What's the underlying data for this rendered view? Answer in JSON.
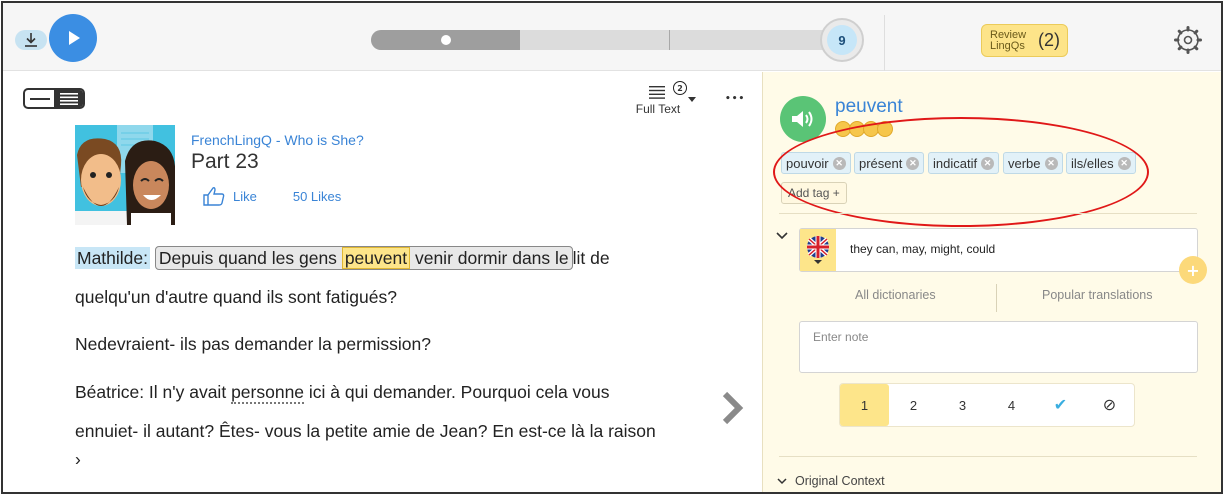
{
  "topbar": {
    "page_number": "9",
    "review_label_1": "Review",
    "review_label_2": "LingQs",
    "review_count": "(2)"
  },
  "reader": {
    "view_mode_label": "Full Text",
    "view_mode_badge": "2",
    "more_label": "•••",
    "course_title": "FrenchLingQ - Who is She?",
    "lesson_title": "Part 23",
    "like_label": "Like",
    "likes_count": "50 Likes",
    "text": {
      "line1": {
        "speaker": "Mathilde:",
        "phrase_before": "Depuis quand les gens",
        "lingq": "peuvent",
        "phrase_after": "venir dormir dans le",
        "rest": "lit de"
      },
      "line2": "quelqu'un d'autre quand ils sont fatigués?",
      "line3": "Nedevraient- ils pas demander la permission?",
      "line4": {
        "before": "Béatrice: Il n'y avait",
        "dotted": "personne",
        "after": "ici à qui demander. Pourquoi cela vous"
      },
      "line5": "ennuiet- il autant? Êtes- vous la petite amie de Jean? En est-ce là la raison",
      "line6": "›"
    }
  },
  "panel": {
    "term": "peuvent",
    "tags": [
      "pouvoir",
      "présent",
      "indicatif",
      "verbe",
      "ils/elles"
    ],
    "add_tag_label": "Add tag +",
    "meaning": "they can, may, might, could",
    "add_meaning_label": "+",
    "dict_tab_1": "All dictionaries",
    "dict_tab_2": "Popular translations",
    "note_placeholder": "Enter note",
    "status_levels": [
      "1",
      "2",
      "3",
      "4",
      "✔",
      "⊘"
    ],
    "status_active": "1",
    "original_context_label": "Original Context"
  },
  "colors": {
    "accent_blue": "#3b8ee3",
    "speaker_green": "#5ac476",
    "lingq_yellow": "#fde58a",
    "annotation_red": "#e01818",
    "panel_bg": "#fffbe8"
  }
}
